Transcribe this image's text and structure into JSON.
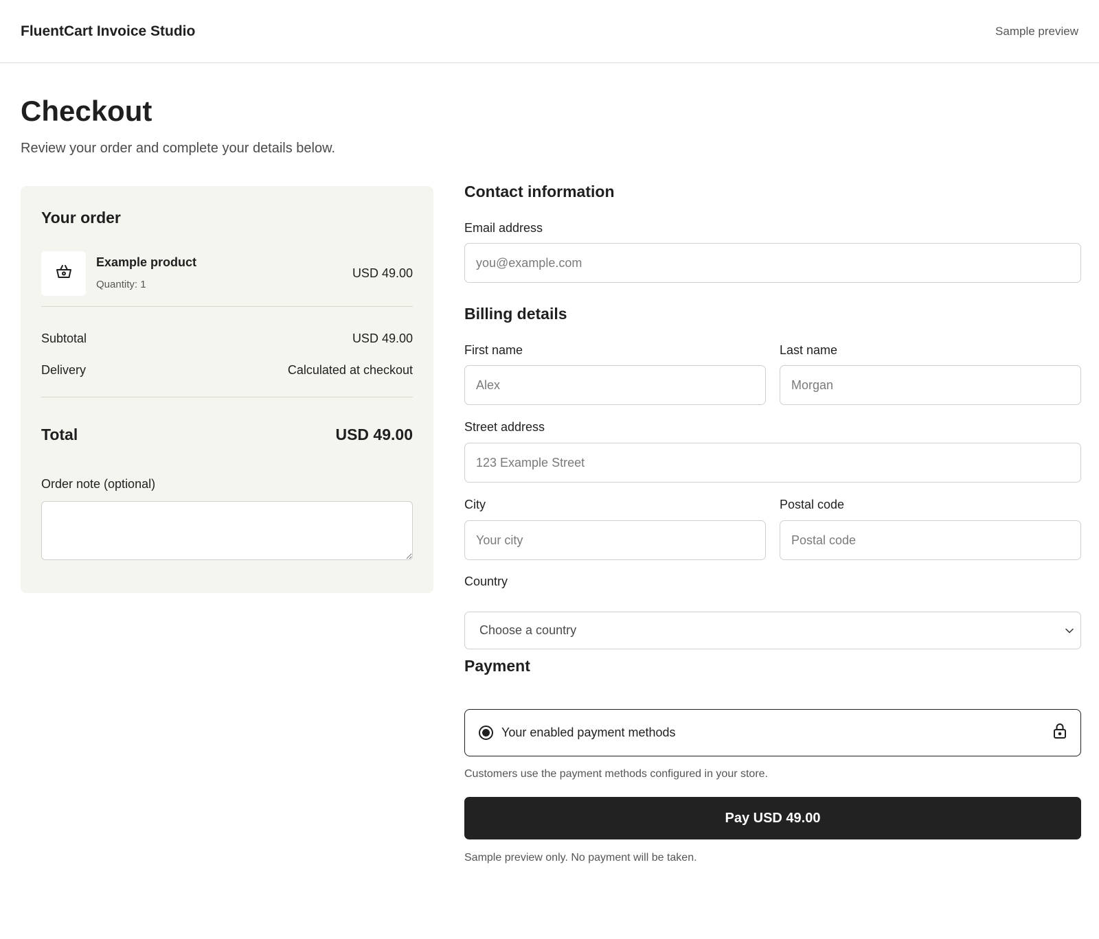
{
  "header": {
    "brand": "FluentCart Invoice Studio",
    "preview_label": "Sample preview"
  },
  "page": {
    "title": "Checkout",
    "subtitle": "Review your order and complete your details below."
  },
  "order": {
    "heading": "Your order",
    "product_icon": "basket-icon",
    "product_name": "Example product",
    "quantity": "Quantity: 1",
    "product_price": "USD 49.00",
    "subtotal_label": "Subtotal",
    "subtotal_value": "USD 49.00",
    "delivery_label": "Delivery",
    "delivery_value": "Calculated at checkout",
    "total_label": "Total",
    "total_value": "USD 49.00",
    "note_label": "Order note (optional)",
    "note_value": ""
  },
  "contact": {
    "title": "Contact information",
    "email_label": "Email address",
    "email_placeholder": "you@example.com",
    "email_value": ""
  },
  "billing": {
    "title": "Billing details",
    "first_name_label": "First name",
    "first_name_placeholder": "Alex",
    "last_name_label": "Last name",
    "last_name_placeholder": "Morgan",
    "street_label": "Street address",
    "street_placeholder": "123 Example Street",
    "city_label": "City",
    "city_placeholder": "Your city",
    "postal_label": "Postal code",
    "postal_placeholder": "Postal code",
    "country_label": "Country",
    "country_selected": "Choose a country"
  },
  "payment": {
    "title": "Payment",
    "method_label": "Your enabled payment methods",
    "method_icon": "lock-icon",
    "help_text": "Customers use the payment methods configured in your store.",
    "pay_button": "Pay USD 49.00",
    "disclaimer": "Sample preview only. No payment will be taken."
  },
  "colors": {
    "card_background": "#f5f5ef",
    "button_background": "#222222",
    "border": "#cfcfcf"
  }
}
